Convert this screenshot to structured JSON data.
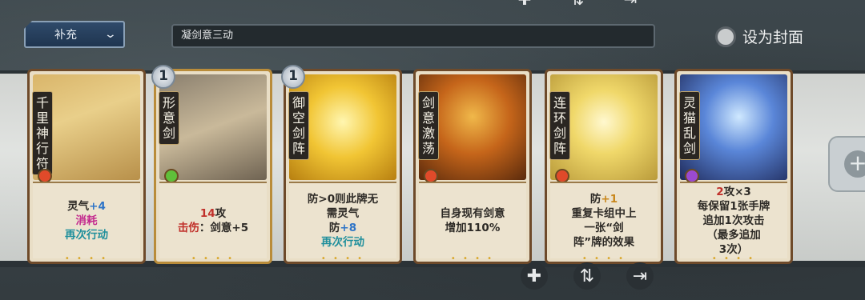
{
  "header": {
    "dropdown_label": "补充",
    "deck_name_value": "凝剑意三动",
    "cover_label": "设为封面"
  },
  "icons": {
    "top": [
      "plus-icon",
      "sort-icon",
      "export-icon"
    ],
    "bottom": [
      "plus-icon",
      "sort-icon",
      "export-icon"
    ],
    "right": "plus-icon"
  },
  "cards": [
    {
      "name": "千里神行符",
      "badge": "",
      "lines": [
        [
          {
            "t": "灵气",
            "c": ""
          },
          {
            "t": "+4",
            "c": "blue"
          }
        ],
        [
          {
            "t": "消耗",
            "c": "mag"
          }
        ],
        [
          {
            "t": "再次行动",
            "c": "teal"
          }
        ]
      ],
      "gem_color": "#e04a2a"
    },
    {
      "name": "形意剑",
      "badge": "1",
      "lines": [
        [
          {
            "t": "14",
            "c": "red"
          },
          {
            "t": "攻",
            "c": ""
          }
        ],
        [
          {
            "t": "击伤",
            "c": "red"
          },
          {
            "t": "：剑意+5",
            "c": ""
          }
        ]
      ],
      "gem_color": "#5fbf3a"
    },
    {
      "name": "御空剑阵",
      "badge": "1",
      "lines": [
        [
          {
            "t": "防>0则此牌无",
            "c": ""
          }
        ],
        [
          {
            "t": "需灵气",
            "c": ""
          }
        ],
        [
          {
            "t": "防",
            "c": ""
          },
          {
            "t": "+8",
            "c": "blue"
          }
        ],
        [
          {
            "t": "再次行动",
            "c": "teal"
          }
        ]
      ],
      "gem_color": ""
    },
    {
      "name": "剑意激荡",
      "badge": "",
      "lines": [
        [
          {
            "t": "自身现有剑意",
            "c": ""
          }
        ],
        [
          {
            "t": "增加110%",
            "c": ""
          }
        ]
      ],
      "gem_color": "#e04a2a"
    },
    {
      "name": "连环剑阵",
      "badge": "",
      "lines": [
        [
          {
            "t": "防",
            "c": ""
          },
          {
            "t": "+1",
            "c": "gold"
          }
        ],
        [
          {
            "t": "重复卡组中上",
            "c": ""
          }
        ],
        [
          {
            "t": "一张“剑",
            "c": ""
          }
        ],
        [
          {
            "t": "阵”牌的效果",
            "c": ""
          }
        ]
      ],
      "gem_color": "#e04a2a"
    },
    {
      "name": "灵猫乱剑",
      "badge": "",
      "lines": [
        [
          {
            "t": "2",
            "c": "red"
          },
          {
            "t": "攻×3",
            "c": ""
          }
        ],
        [
          {
            "t": "每保留1张手牌",
            "c": ""
          }
        ],
        [
          {
            "t": "追加1次攻击",
            "c": ""
          }
        ],
        [
          {
            "t": "（最多追加",
            "c": ""
          }
        ],
        [
          {
            "t": "3次）",
            "c": ""
          }
        ]
      ],
      "gem_color": "#9a4ad0"
    }
  ]
}
